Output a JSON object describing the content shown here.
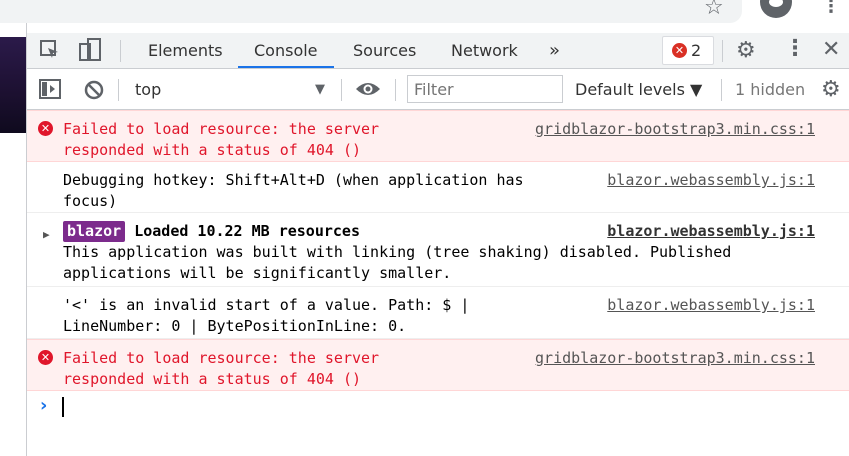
{
  "devtools": {
    "tabs": [
      "Elements",
      "Console",
      "Sources",
      "Network"
    ],
    "more_tabs_label": "»",
    "error_count": "2",
    "context_select": "top",
    "filter_placeholder": "Filter",
    "levels_label": "Default levels ▼",
    "hidden_label": "1 hidden"
  },
  "console": {
    "messages": [
      {
        "level": "error",
        "text": "Failed to load resource: the server\nresponded with a status of 404 ()",
        "source": "gridblazor-bootstrap3.min.css:1"
      },
      {
        "level": "info",
        "text": "Debugging hotkey: Shift+Alt+D (when application has\nfocus)",
        "source": "blazor.webassembly.js:1"
      },
      {
        "level": "info",
        "badge": "blazor",
        "title": "Loaded 10.22 MB resources",
        "text": "This application was built with linking (tree shaking) disabled. Published\napplications will be significantly smaller.",
        "source": "blazor.webassembly.js:1"
      },
      {
        "level": "info",
        "text": "'<' is an invalid start of a value. Path: $ |\nLineNumber: 0 | BytePositionInLine: 0.",
        "source": "blazor.webassembly.js:1"
      },
      {
        "level": "error",
        "text": "Failed to load resource: the server\nresponded with a status of 404 ()",
        "source": "gridblazor-bootstrap3.min.css:1"
      }
    ],
    "prompt_symbol": "›"
  },
  "colors": {
    "error_text": "#e0162b",
    "error_bg": "#fff0f0",
    "accent": "#1a73e8",
    "blazor_badge": "#7c2b8c"
  },
  "icons": [
    "star-icon",
    "account-avatar-icon",
    "chrome-menu-icon",
    "inspect-element-icon",
    "device-toolbar-icon",
    "gear-icon",
    "kebab-menu-icon",
    "close-icon",
    "sidebar-toggle-icon",
    "clear-console-icon",
    "eye-icon",
    "gear-icon",
    "error-icon",
    "expand-arrow-icon",
    "prompt-icon"
  ]
}
